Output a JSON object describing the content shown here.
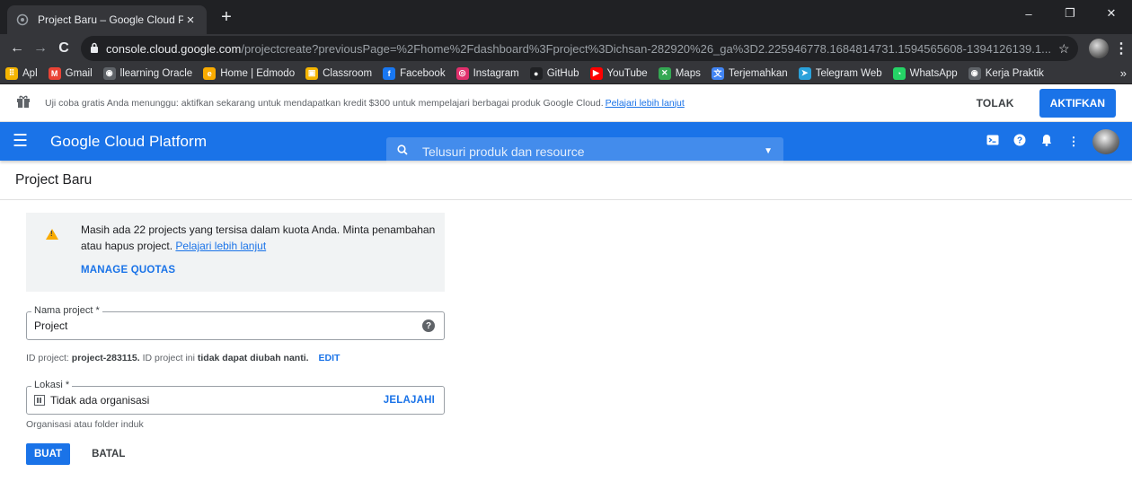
{
  "browser": {
    "tab_title": "Project Baru – Google Cloud Platf",
    "url_host": "console.cloud.google.com",
    "url_path": "/projectcreate?previousPage=%2Fhome%2Fdashboard%3Fproject%3Dichsan-282920%26_ga%3D2.225946778.1684814731.1594565608-1394126139.1...",
    "bookmarks": [
      {
        "label": "Apl",
        "icon": "apps-grid-icon",
        "color": "#f4b400"
      },
      {
        "label": "Gmail",
        "icon": "gmail-icon",
        "color": "#ea4335"
      },
      {
        "label": "llearning Oracle",
        "icon": "globe-icon",
        "color": "#5f6368"
      },
      {
        "label": "Home | Edmodo",
        "icon": "edmodo-icon",
        "color": "#f9ab00"
      },
      {
        "label": "Classroom",
        "icon": "classroom-icon",
        "color": "#f4b400"
      },
      {
        "label": "Facebook",
        "icon": "facebook-icon",
        "color": "#1877f2"
      },
      {
        "label": "Instagram",
        "icon": "instagram-icon",
        "color": "#e1306c"
      },
      {
        "label": "GitHub",
        "icon": "github-icon",
        "color": "#202124"
      },
      {
        "label": "YouTube",
        "icon": "youtube-icon",
        "color": "#ff0000"
      },
      {
        "label": "Maps",
        "icon": "maps-icon",
        "color": "#34a853"
      },
      {
        "label": "Terjemahkan",
        "icon": "translate-icon",
        "color": "#4285f4"
      },
      {
        "label": "Telegram Web",
        "icon": "telegram-icon",
        "color": "#2aa1da"
      },
      {
        "label": "WhatsApp",
        "icon": "whatsapp-icon",
        "color": "#25d366"
      },
      {
        "label": "Kerja Praktik",
        "icon": "globe-icon",
        "color": "#5f6368"
      }
    ],
    "bookmarks_more": "»"
  },
  "promo": {
    "text": "Uji coba gratis Anda menunggu: aktifkan sekarang untuk mendapatkan kredit $300 untuk mempelajari berbagai produk Google Cloud.",
    "link": "Pelajari lebih lanjut",
    "dismiss": "TOLAK",
    "activate": "AKTIFKAN"
  },
  "topbar": {
    "brand": "Google Cloud Platform",
    "search_placeholder": "Telusuri produk dan resource",
    "accent": "#1a73e8"
  },
  "page": {
    "title": "Project Baru"
  },
  "quota": {
    "message": "Masih ada 22 projects yang tersisa dalam kuota Anda. Minta penambahan atau hapus project.",
    "link": "Pelajari lebih lanjut",
    "manage": "MANAGE QUOTAS"
  },
  "form": {
    "name_label": "Nama project *",
    "name_value": "Project",
    "id_prefix": "ID project:",
    "id_value": "project-283115.",
    "id_mid": "ID project ini",
    "id_bold": "tidak dapat diubah nanti.",
    "id_edit": "EDIT",
    "location_label": "Lokasi *",
    "location_value": "Tidak ada organisasi",
    "location_browse": "JELAJAHI",
    "location_hint": "Organisasi atau folder induk",
    "create": "BUAT",
    "cancel": "BATAL"
  }
}
